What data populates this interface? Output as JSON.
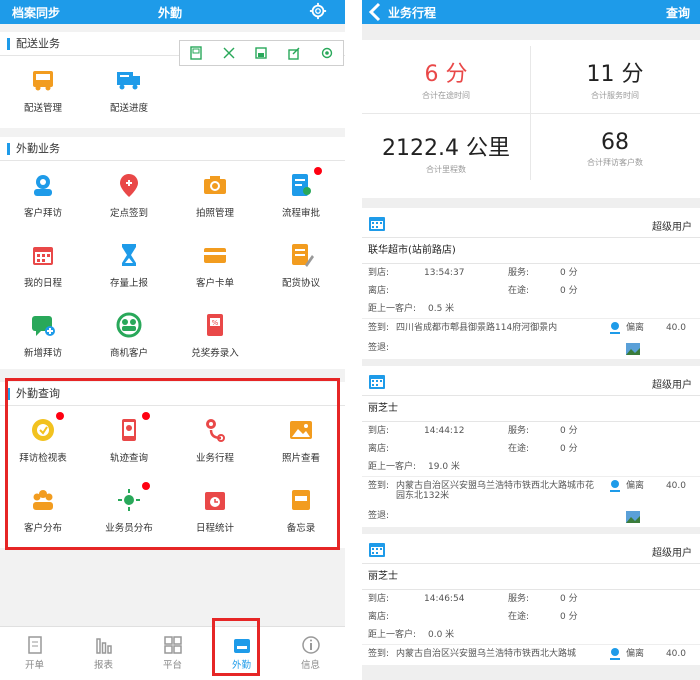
{
  "left": {
    "topbar": {
      "sync": "档案同步",
      "title": "外勤"
    },
    "sections": [
      {
        "title": "配送业务",
        "items": [
          {
            "label": "配送管理",
            "icon": "truck-icon",
            "color": "#f29c1f"
          },
          {
            "label": "配送进度",
            "icon": "delivery-progress-icon",
            "color": "#1e9be9"
          }
        ]
      },
      {
        "title": "外勤业务",
        "items": [
          {
            "label": "客户拜访",
            "icon": "customer-visit-icon",
            "color": "#1e9be9"
          },
          {
            "label": "定点签到",
            "icon": "location-pin-icon",
            "color": "#e94848"
          },
          {
            "label": "拍照管理",
            "icon": "camera-icon",
            "color": "#f29c1f"
          },
          {
            "label": "流程审批",
            "icon": "approval-icon",
            "color": "#1e9be9"
          },
          {
            "label": "我的日程",
            "icon": "calendar-icon",
            "color": "#e94848"
          },
          {
            "label": "存量上报",
            "icon": "hourglass-icon",
            "color": "#1e9be9"
          },
          {
            "label": "客户卡单",
            "icon": "card-icon",
            "color": "#f29c1f"
          },
          {
            "label": "配货协议",
            "icon": "agreement-icon",
            "color": "#f29c1f"
          },
          {
            "label": "新增拜访",
            "icon": "add-visit-icon",
            "color": "#29a85a"
          },
          {
            "label": "商机客户",
            "icon": "business-customer-icon",
            "color": "#29a85a"
          },
          {
            "label": "兑奖券录入",
            "icon": "coupon-icon",
            "color": "#e94848"
          }
        ]
      },
      {
        "title": "外勤查询",
        "items": [
          {
            "label": "拜访检视表",
            "icon": "visit-review-icon",
            "color": "#f2c21f"
          },
          {
            "label": "轨迹查询",
            "icon": "track-query-icon",
            "color": "#e94848"
          },
          {
            "label": "业务行程",
            "icon": "business-trip-icon",
            "color": "#e94848"
          },
          {
            "label": "照片查看",
            "icon": "photo-view-icon",
            "color": "#f29c1f"
          },
          {
            "label": "客户分布",
            "icon": "customer-distribution-icon",
            "color": "#f29c1f"
          },
          {
            "label": "业务员分布",
            "icon": "salesman-distribution-icon",
            "color": "#29a85a"
          },
          {
            "label": "日程统计",
            "icon": "schedule-stats-icon",
            "color": "#e94848"
          },
          {
            "label": "备忘录",
            "icon": "memo-icon",
            "color": "#f29c1f"
          }
        ]
      }
    ],
    "nav": [
      {
        "label": "开单",
        "icon": "order-icon"
      },
      {
        "label": "报表",
        "icon": "report-icon"
      },
      {
        "label": "平台",
        "icon": "platform-icon"
      },
      {
        "label": "外勤",
        "icon": "field-icon"
      },
      {
        "label": "信息",
        "icon": "info-icon"
      }
    ]
  },
  "right": {
    "topbar": {
      "title": "业务行程",
      "query": "查询"
    },
    "stats": [
      {
        "value": "6 分",
        "label": "合计在途时间",
        "color": "#e94848"
      },
      {
        "value": "11 分",
        "label": "合计服务时间",
        "color": "#222222"
      },
      {
        "value": "2122.4 公里",
        "label": "合计里程数",
        "color": "#222222"
      },
      {
        "value": "68",
        "label": "合计拜访客户数",
        "color": "#222222"
      }
    ],
    "cards": [
      {
        "user": "超级用户",
        "name": "联华超市(站前路店)",
        "arrive_label": "到店:",
        "arrive": "13:54:37",
        "service_label": "服务:",
        "service": "0 分",
        "leave_label": "离店:",
        "transit_label": "在途:",
        "transit": "0 分",
        "dist_label": "距上一客户:",
        "dist": "0.5 米",
        "sign_label": "签到:",
        "sign": "四川省成都市郫县御景路114府河御景内",
        "deviation_label": "偏离",
        "deviation": "40.0",
        "signout_label": "签退:"
      },
      {
        "user": "超级用户",
        "name": "丽芝士",
        "arrive_label": "到店:",
        "arrive": "14:44:12",
        "service_label": "服务:",
        "service": "0 分",
        "leave_label": "离店:",
        "transit_label": "在途:",
        "transit": "0 分",
        "dist_label": "距上一客户:",
        "dist": "19.0 米",
        "sign_label": "签到:",
        "sign": "内蒙古自治区兴安盟乌兰浩特市铁西北大路城市花园东北132米",
        "deviation_label": "偏离",
        "deviation": "40.0",
        "signout_label": "签退:"
      },
      {
        "user": "超级用户",
        "name": "丽芝士",
        "arrive_label": "到店:",
        "arrive": "14:46:54",
        "service_label": "服务:",
        "service": "0 分",
        "leave_label": "离店:",
        "transit_label": "在途:",
        "transit": "0 分",
        "dist_label": "距上一客户:",
        "dist": "0.0 米",
        "sign_label": "签到:",
        "sign": "内蒙古自治区兴安盟乌兰浩特市铁西北大路城",
        "deviation_label": "偏离",
        "deviation": "40.0",
        "signout_label": ""
      }
    ]
  }
}
